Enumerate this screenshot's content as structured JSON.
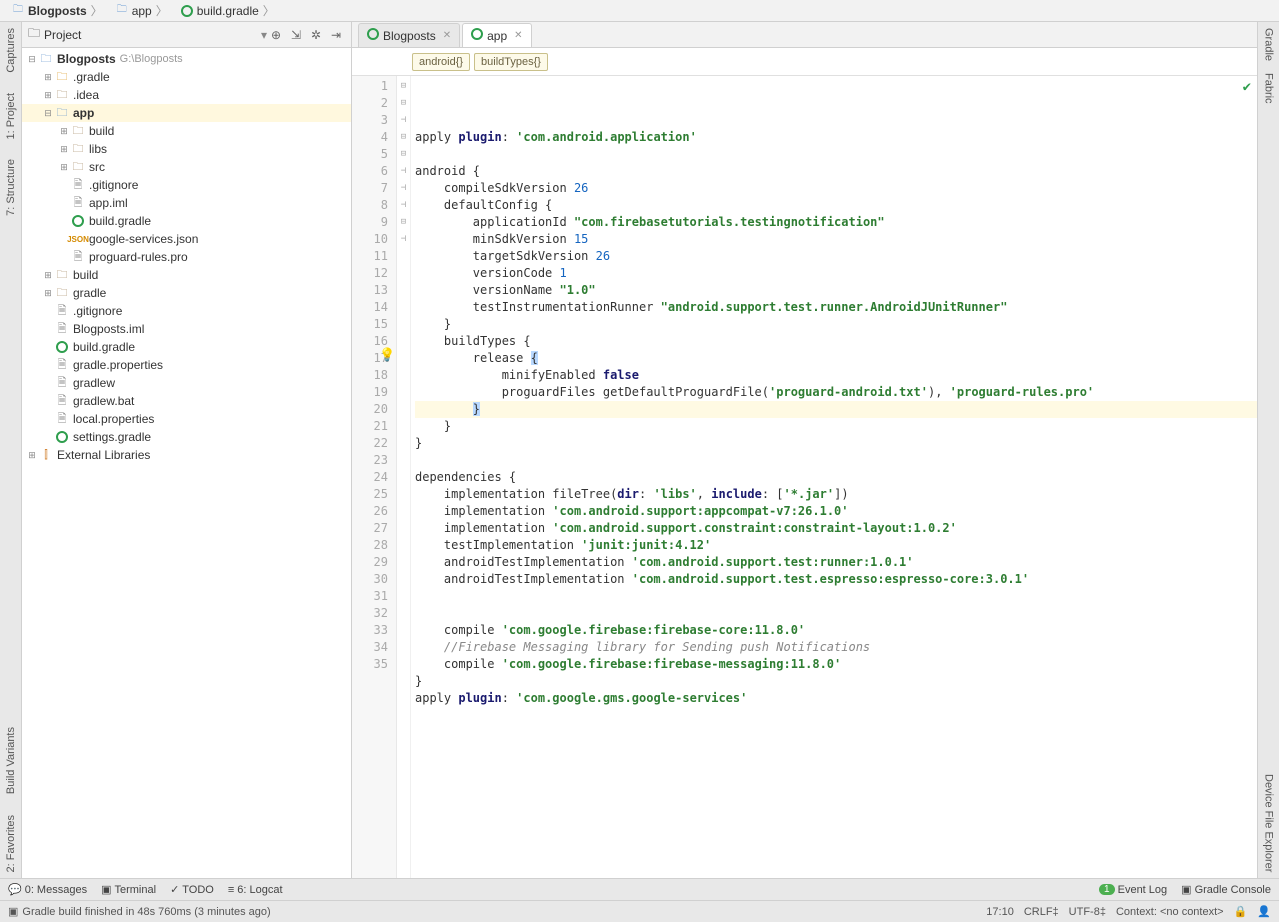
{
  "breadcrumb": [
    {
      "icon": "folder",
      "label": "Blogposts",
      "bold": true
    },
    {
      "icon": "folder",
      "label": "app"
    },
    {
      "icon": "gradle",
      "label": "build.gradle"
    }
  ],
  "left_gutter": [
    {
      "label": "Captures",
      "key": "captures"
    },
    {
      "label": "1: Project",
      "key": "project"
    },
    {
      "label": "7: Structure",
      "key": "structure"
    },
    {
      "label": "Build Variants",
      "key": "build-variants"
    },
    {
      "label": "2: Favorites",
      "key": "favorites"
    }
  ],
  "right_gutter": [
    {
      "label": "Gradle",
      "key": "gradle"
    },
    {
      "label": "Fabric",
      "key": "fabric"
    },
    {
      "label": "Device File Explorer",
      "key": "device-file-explorer"
    }
  ],
  "panel": {
    "title": "Project"
  },
  "tree": [
    {
      "i": 0,
      "t": "⊟",
      "ic": "module",
      "lbl": "Blogposts",
      "bold": true,
      "path": "G:\\Blogposts"
    },
    {
      "i": 1,
      "t": "⊞",
      "ic": "folder-orange",
      "lbl": ".gradle"
    },
    {
      "i": 1,
      "t": "⊞",
      "ic": "folder",
      "lbl": ".idea"
    },
    {
      "i": 1,
      "t": "⊟",
      "ic": "module",
      "lbl": "app",
      "bold": true,
      "sel": true
    },
    {
      "i": 2,
      "t": "⊞",
      "ic": "folder",
      "lbl": "build"
    },
    {
      "i": 2,
      "t": "⊞",
      "ic": "folder",
      "lbl": "libs"
    },
    {
      "i": 2,
      "t": "⊞",
      "ic": "folder",
      "lbl": "src"
    },
    {
      "i": 2,
      "t": "",
      "ic": "file",
      "lbl": ".gitignore"
    },
    {
      "i": 2,
      "t": "",
      "ic": "file",
      "lbl": "app.iml"
    },
    {
      "i": 2,
      "t": "",
      "ic": "gradle",
      "lbl": "build.gradle"
    },
    {
      "i": 2,
      "t": "",
      "ic": "json",
      "lbl": "google-services.json"
    },
    {
      "i": 2,
      "t": "",
      "ic": "file",
      "lbl": "proguard-rules.pro"
    },
    {
      "i": 1,
      "t": "⊞",
      "ic": "folder",
      "lbl": "build"
    },
    {
      "i": 1,
      "t": "⊞",
      "ic": "folder",
      "lbl": "gradle"
    },
    {
      "i": 1,
      "t": "",
      "ic": "file",
      "lbl": ".gitignore"
    },
    {
      "i": 1,
      "t": "",
      "ic": "file",
      "lbl": "Blogposts.iml"
    },
    {
      "i": 1,
      "t": "",
      "ic": "gradle",
      "lbl": "build.gradle"
    },
    {
      "i": 1,
      "t": "",
      "ic": "file",
      "lbl": "gradle.properties"
    },
    {
      "i": 1,
      "t": "",
      "ic": "file",
      "lbl": "gradlew"
    },
    {
      "i": 1,
      "t": "",
      "ic": "file",
      "lbl": "gradlew.bat"
    },
    {
      "i": 1,
      "t": "",
      "ic": "file",
      "lbl": "local.properties"
    },
    {
      "i": 1,
      "t": "",
      "ic": "gradle",
      "lbl": "settings.gradle"
    },
    {
      "i": 0,
      "t": "⊞",
      "ic": "lib",
      "lbl": "External Libraries"
    }
  ],
  "editor_tabs": [
    {
      "icon": "gradle",
      "label": "Blogposts",
      "active": false
    },
    {
      "icon": "gradle",
      "label": "app",
      "active": true
    }
  ],
  "editor_crumbs": [
    "android{}",
    "buildTypes{}"
  ],
  "code": [
    {
      "n": 1,
      "seg": [
        [
          "id",
          "apply "
        ],
        [
          "kw",
          "plugin"
        ],
        [
          "id",
          ": "
        ],
        [
          "str",
          "'com.android.application'"
        ]
      ]
    },
    {
      "n": 2,
      "seg": [
        [
          "",
          ""
        ]
      ]
    },
    {
      "n": 3,
      "fold": "⊟",
      "seg": [
        [
          "id",
          "android {"
        ]
      ]
    },
    {
      "n": 4,
      "seg": [
        [
          "id",
          "    compileSdkVersion "
        ],
        [
          "num",
          "26"
        ]
      ]
    },
    {
      "n": 5,
      "fold": "⊟",
      "seg": [
        [
          "id",
          "    defaultConfig {"
        ]
      ]
    },
    {
      "n": 6,
      "seg": [
        [
          "id",
          "        applicationId "
        ],
        [
          "str",
          "\"com.firebasetutorials.testingnotification\""
        ]
      ]
    },
    {
      "n": 7,
      "seg": [
        [
          "id",
          "        minSdkVersion "
        ],
        [
          "num",
          "15"
        ]
      ]
    },
    {
      "n": 8,
      "seg": [
        [
          "id",
          "        targetSdkVersion "
        ],
        [
          "num",
          "26"
        ]
      ]
    },
    {
      "n": 9,
      "seg": [
        [
          "id",
          "        versionCode "
        ],
        [
          "num",
          "1"
        ]
      ]
    },
    {
      "n": 10,
      "seg": [
        [
          "id",
          "        versionName "
        ],
        [
          "str",
          "\"1.0\""
        ]
      ]
    },
    {
      "n": 11,
      "seg": [
        [
          "id",
          "        testInstrumentationRunner "
        ],
        [
          "str",
          "\"android.support.test.runner.AndroidJUnitRunner\""
        ]
      ]
    },
    {
      "n": 12,
      "fold": "⊣",
      "seg": [
        [
          "id",
          "    }"
        ]
      ]
    },
    {
      "n": 13,
      "fold": "⊟",
      "seg": [
        [
          "id",
          "    buildTypes {"
        ]
      ]
    },
    {
      "n": 14,
      "fold": "⊟",
      "seg": [
        [
          "id",
          "        release "
        ],
        [
          "sel",
          "{"
        ]
      ]
    },
    {
      "n": 15,
      "seg": [
        [
          "id",
          "            minifyEnabled "
        ],
        [
          "false",
          "false"
        ]
      ]
    },
    {
      "n": 16,
      "seg": [
        [
          "id",
          "            proguardFiles getDefaultProguardFile("
        ],
        [
          "str",
          "'proguard-android.txt'"
        ],
        [
          "id",
          "), "
        ],
        [
          "str",
          "'proguard-rules.pro'"
        ]
      ]
    },
    {
      "n": 17,
      "hl": true,
      "fold": "⊣",
      "seg": [
        [
          "id",
          "        "
        ],
        [
          "sel",
          "}"
        ]
      ]
    },
    {
      "n": 18,
      "fold": "⊣",
      "seg": [
        [
          "id",
          "    }"
        ]
      ]
    },
    {
      "n": 19,
      "fold": "⊣",
      "seg": [
        [
          "id",
          "}"
        ]
      ]
    },
    {
      "n": 20,
      "seg": [
        [
          "",
          ""
        ]
      ]
    },
    {
      "n": 21,
      "fold": "⊟",
      "seg": [
        [
          "id",
          "dependencies {"
        ]
      ]
    },
    {
      "n": 22,
      "seg": [
        [
          "id",
          "    implementation fileTree("
        ],
        [
          "kw",
          "dir"
        ],
        [
          "id",
          ": "
        ],
        [
          "str",
          "'libs'"
        ],
        [
          "id",
          ", "
        ],
        [
          "kw",
          "include"
        ],
        [
          "id",
          ": ["
        ],
        [
          "str",
          "'*.jar'"
        ],
        [
          "id",
          "])"
        ]
      ]
    },
    {
      "n": 23,
      "seg": [
        [
          "id",
          "    implementation "
        ],
        [
          "str",
          "'com.android.support:appcompat-v7:26.1.0'"
        ]
      ]
    },
    {
      "n": 24,
      "seg": [
        [
          "id",
          "    implementation "
        ],
        [
          "str",
          "'com.android.support.constraint:constraint-layout:1.0.2'"
        ]
      ]
    },
    {
      "n": 25,
      "seg": [
        [
          "id",
          "    testImplementation "
        ],
        [
          "str",
          "'junit:junit:4.12'"
        ]
      ]
    },
    {
      "n": 26,
      "seg": [
        [
          "id",
          "    androidTestImplementation "
        ],
        [
          "str",
          "'com.android.support.test:runner:1.0.1'"
        ]
      ]
    },
    {
      "n": 27,
      "seg": [
        [
          "id",
          "    androidTestImplementation "
        ],
        [
          "str",
          "'com.android.support.test.espresso:espresso-core:3.0.1'"
        ]
      ]
    },
    {
      "n": 28,
      "seg": [
        [
          "",
          ""
        ]
      ]
    },
    {
      "n": 29,
      "seg": [
        [
          "",
          ""
        ]
      ]
    },
    {
      "n": 30,
      "seg": [
        [
          "id",
          "    compile "
        ],
        [
          "str",
          "'com.google.firebase:firebase-core:11.8.0'"
        ]
      ]
    },
    {
      "n": 31,
      "seg": [
        [
          "cmt",
          "    //Firebase Messaging library for Sending push Notifications"
        ]
      ]
    },
    {
      "n": 32,
      "seg": [
        [
          "id",
          "    compile "
        ],
        [
          "str",
          "'com.google.firebase:firebase-messaging:11.8.0'"
        ]
      ]
    },
    {
      "n": 33,
      "fold": "⊣",
      "seg": [
        [
          "id",
          "}"
        ]
      ]
    },
    {
      "n": 34,
      "seg": [
        [
          "id",
          "apply "
        ],
        [
          "kw",
          "plugin"
        ],
        [
          "id",
          ": "
        ],
        [
          "str",
          "'com.google.gms.google-services'"
        ]
      ]
    },
    {
      "n": 35,
      "seg": [
        [
          "",
          ""
        ]
      ]
    }
  ],
  "bottom_toolbar": {
    "left": [
      {
        "icon": "💬",
        "label": "0: Messages",
        "key": "messages"
      },
      {
        "icon": "▣",
        "label": "Terminal",
        "key": "terminal"
      },
      {
        "icon": "✓",
        "label": "TODO",
        "key": "todo"
      },
      {
        "icon": "≡",
        "label": "6: Logcat",
        "key": "logcat"
      }
    ],
    "right": [
      {
        "badge": "1",
        "label": "Event Log",
        "key": "event-log"
      },
      {
        "icon": "▣",
        "label": "Gradle Console",
        "key": "gradle-console"
      }
    ]
  },
  "status": {
    "message": "Gradle build finished in 48s 760ms (3 minutes ago)",
    "cursor": "17:10",
    "eol": "CRLF‡",
    "enc": "UTF-8‡",
    "context": "Context: <no context>"
  }
}
